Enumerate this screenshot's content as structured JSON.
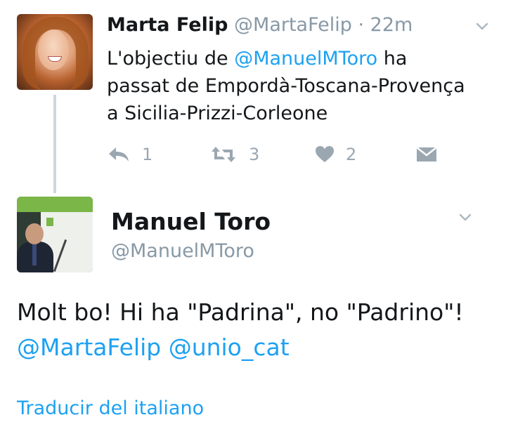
{
  "reply_tweet": {
    "author_name": "Marta Felip",
    "author_handle": "@MartaFelip",
    "separator": " · ",
    "time_ago": "22m",
    "text_before": "L'objectiu de ",
    "mention": "@ManuelMToro",
    "text_after": " ha passat de Empordà-Toscana-Provença a Sicilia-Prizzi-Corleone",
    "actions": {
      "reply_icon": "reply-icon",
      "reply_count": "1",
      "retweet_icon": "retweet-icon",
      "retweet_count": "3",
      "like_icon": "heart-icon",
      "like_count": "2",
      "dm_icon": "direct-message-icon"
    }
  },
  "main_tweet": {
    "author_name": "Manuel Toro",
    "author_handle": "@ManuelMToro",
    "text": "Molt bo! Hi ha \"Padrina\", no \"Padrino\"!",
    "mention_1": "@MartaFelip",
    "mention_2": "@unio_cat",
    "translate_link": "Traducir del italiano"
  },
  "colors": {
    "link": "#1da1f2",
    "meta": "#8899a6",
    "icon": "#9aa7b1",
    "thread_line": "#ccd6dd"
  }
}
